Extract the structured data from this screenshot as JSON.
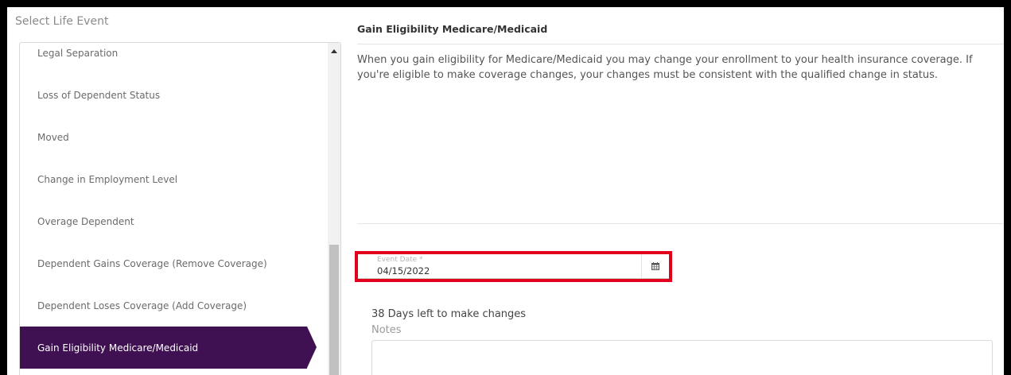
{
  "left_panel": {
    "title": "Select Life Event",
    "items": [
      {
        "label": "Legal Separation"
      },
      {
        "label": "Loss of Dependent Status"
      },
      {
        "label": "Moved"
      },
      {
        "label": "Change in Employment Level"
      },
      {
        "label": "Overage Dependent"
      },
      {
        "label": "Dependent Gains Coverage (Remove Coverage)"
      },
      {
        "label": "Dependent Loses Coverage (Add Coverage)"
      },
      {
        "label": "Gain Eligibility Medicare/Medicaid",
        "selected": true
      }
    ]
  },
  "detail": {
    "title": "Gain Eligibility Medicare/Medicaid",
    "description": "When you gain eligibility for Medicare/Medicaid you may change your enrollment to your health insurance coverage. If you're eligible to make coverage changes, your changes must be consistent with the qualified change in status.",
    "event_date": {
      "label": "Event Date *",
      "value": "04/15/2022",
      "icon": "calendar-icon"
    },
    "days_left": "38 Days left to make changes",
    "notes_label": "Notes",
    "notes_value": ""
  },
  "colors": {
    "selected_bg": "#3f1152",
    "highlight_border": "#e3001b"
  }
}
